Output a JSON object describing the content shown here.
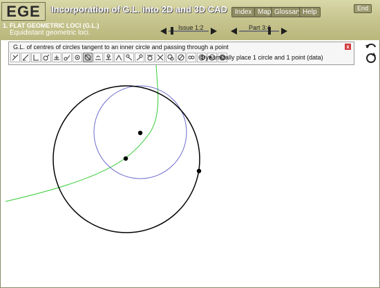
{
  "header": {
    "logo": "EGE",
    "title": "Incorporation of G.L. into 2D and 3D CAD",
    "nav": {
      "index": "Index",
      "map": "Map",
      "glossary": "Glossary",
      "help": "Help",
      "end": "End"
    },
    "section_title": "1. FLAT GEOMETRIC LOCI (G.L.)",
    "section_subtitle": "Equidistant geometric loci.",
    "issue_label": "Issue 1:2",
    "part_label": "Part 3:4"
  },
  "panel": {
    "title": "G.L. of centres of circles tangent to an inner circle and passing through a point",
    "close": "x",
    "hint": "Dynamically place 1 circle and 1 point (data)",
    "tools_count": 21,
    "active_tool_index": 7
  },
  "colors": {
    "header_bg": "#c8c690",
    "locus_curve": "#33cc33",
    "inner_circle": "#6b6bcc",
    "outer_circle": "#000000",
    "close_button": "#d23a3a"
  },
  "icons": {
    "undo": "undo-arrow-icon",
    "redo": "redo-circle-icon"
  }
}
